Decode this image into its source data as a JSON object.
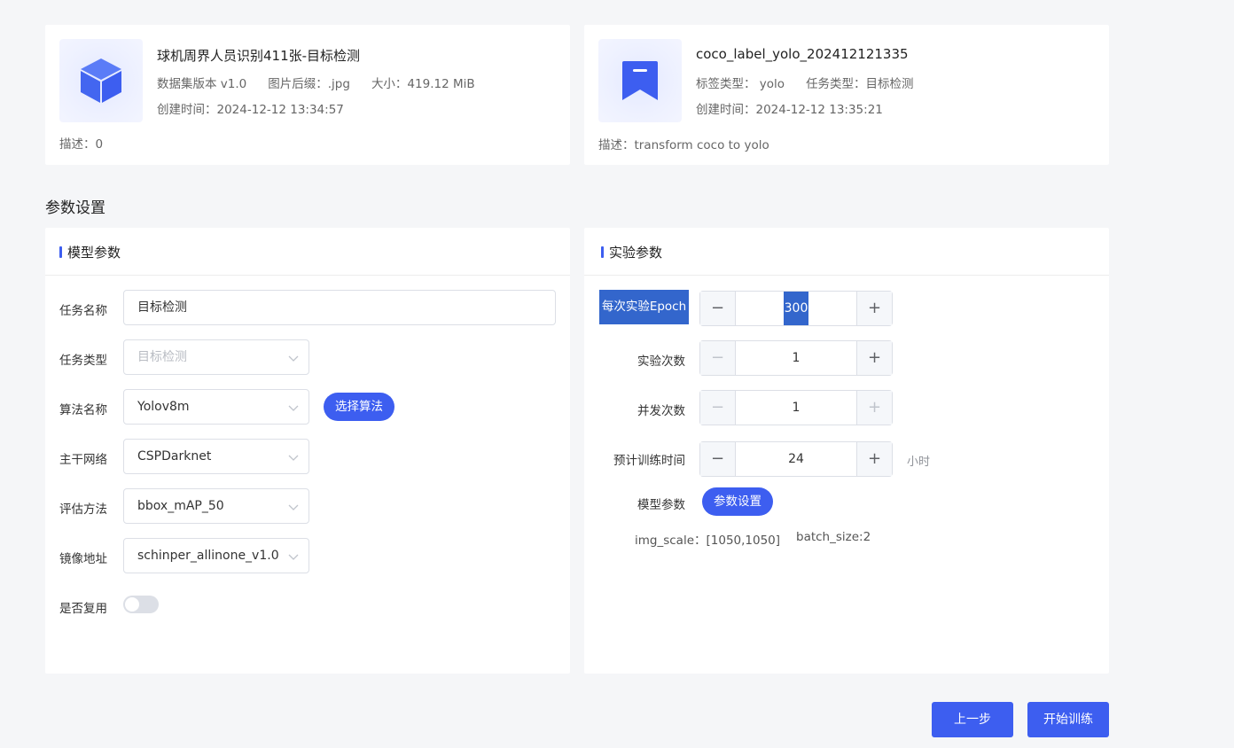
{
  "dataset": {
    "title": "球机周界人员识别411张-目标检测",
    "version_label": "数据集版本 v1.0",
    "suffix_label": "图片后缀：.jpg",
    "size_label": "大小：419.12 MiB",
    "created_label": "创建时间：2024-12-12 13:34:57",
    "desc_label": "描述：0"
  },
  "label_set": {
    "title": "coco_label_yolo_202412121335",
    "label_type": "标签类型： yolo",
    "task_type": "任务类型：目标检测",
    "created_label": "创建时间：2024-12-12 13:35:21",
    "desc_label": "描述：transform coco to yolo"
  },
  "section_title": "参数设置",
  "model_panel": {
    "title": "模型参数",
    "task_name": {
      "label": "任务名称",
      "value": "目标检测"
    },
    "task_type": {
      "label": "任务类型",
      "value": "目标检测"
    },
    "algorithm": {
      "label": "算法名称",
      "value": "Yolov8m",
      "button": "选择算法"
    },
    "backbone": {
      "label": "主干网络",
      "value": "CSPDarknet"
    },
    "eval": {
      "label": "评估方法",
      "value": "bbox_mAP_50"
    },
    "image": {
      "label": "镜像地址",
      "value": "schinper_allinone_v1.0"
    },
    "reuse": {
      "label": "是否复用",
      "on": false
    }
  },
  "exp_panel": {
    "title": "实验参数",
    "epoch": {
      "label": "每次实验Epoch",
      "value": "300"
    },
    "runs": {
      "label": "实验次数",
      "value": "1"
    },
    "concurrency": {
      "label": "并发次数",
      "value": "1"
    },
    "train_time": {
      "label": "预计训练时间",
      "value": "24",
      "unit": "小时"
    },
    "model_params": {
      "label": "模型参数",
      "button": "参数设置"
    },
    "img_scale": "img_scale：[1050,1050]",
    "batch_size": "batch_size:2",
    "minus": "−",
    "plus": "+"
  },
  "footer": {
    "prev": "上一步",
    "start": "开始训练"
  },
  "colors": {
    "accent": "#3d5ef0",
    "background": "#f5f6f8"
  }
}
